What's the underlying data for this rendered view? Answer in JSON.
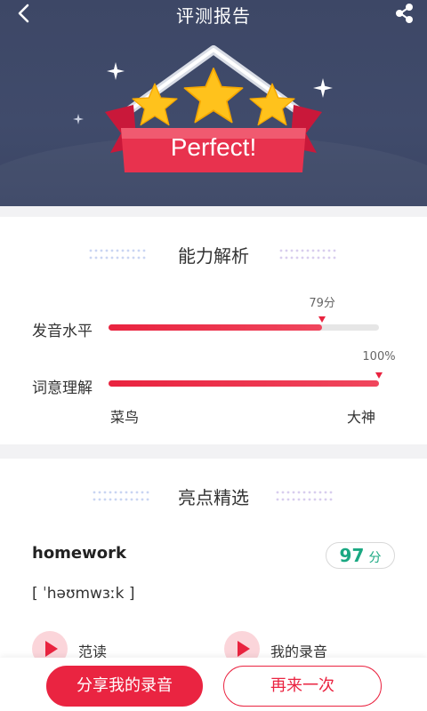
{
  "header": {
    "title": "评测报告",
    "badge_text": "Perfect!",
    "stars": 3
  },
  "ability": {
    "title": "能力解析",
    "rows": [
      {
        "label": "发音水平",
        "score_text": "79分",
        "value": 79
      },
      {
        "label": "词意理解",
        "score_text": "100%",
        "value": 100
      }
    ],
    "scale_min": "菜鸟",
    "scale_max": "大神"
  },
  "highlight": {
    "title": "亮点精选",
    "word": "homework",
    "score_num": "97",
    "score_unit": "分",
    "phonetic": "[ ˈhəʊmwɜːk ]",
    "play_sample_label": "范读",
    "play_mine_label": "我的录音"
  },
  "actions": {
    "share_label": "分享我的录音",
    "retry_label": "再来一次"
  },
  "colors": {
    "accent": "#e9233f",
    "header_bg": "#3e4868",
    "score_green": "#1aa882"
  }
}
